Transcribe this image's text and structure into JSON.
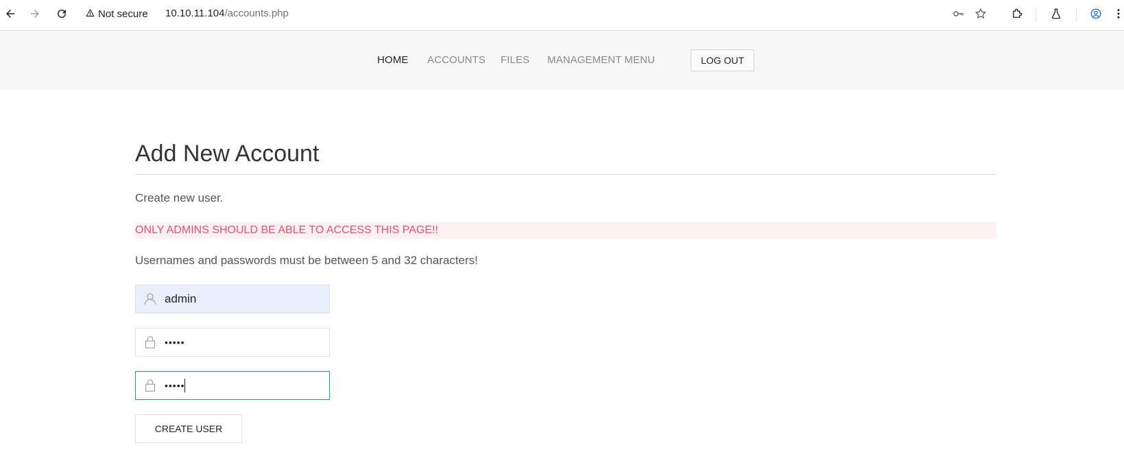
{
  "browser": {
    "security_label": "Not secure",
    "url_host": "10.10.11.104",
    "url_path": "/accounts.php"
  },
  "nav": {
    "items": [
      {
        "label": "HOME",
        "active": true
      },
      {
        "label": "ACCOUNTS",
        "active": false
      },
      {
        "label": "FILES",
        "active": false
      },
      {
        "label": "MANAGEMENT MENU",
        "active": false
      }
    ],
    "logout_label": "LOG OUT"
  },
  "main": {
    "title": "Add New Account",
    "subtitle": "Create new user.",
    "warning": "ONLY ADMINS SHOULD BE ABLE TO ACCESS THIS PAGE!!",
    "requirements": "Usernames and passwords must be between 5 and 32 characters!",
    "username_value": "admin",
    "password_value": "•••••",
    "confirm_value": "•••••",
    "submit_label": "CREATE USER"
  },
  "colors": {
    "alert_text": "#f0506e",
    "alert_bg": "#fff0f2",
    "focus_border": "#1e87f0",
    "autofill_bg": "#e8f0fe"
  },
  "icons": [
    "back-arrow-icon",
    "forward-arrow-icon",
    "reload-icon",
    "warning-icon",
    "key-icon",
    "star-icon",
    "extensions-icon",
    "labs-flask-icon",
    "profile-icon",
    "menu-dots-icon",
    "user-icon",
    "lock-icon"
  ]
}
